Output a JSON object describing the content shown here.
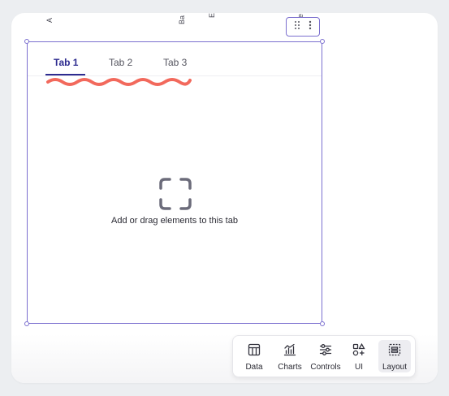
{
  "clipped_labels": [
    "A",
    "Ba",
    "E",
    "e"
  ],
  "tabs": [
    {
      "label": "Tab 1",
      "active": true
    },
    {
      "label": "Tab 2",
      "active": false
    },
    {
      "label": "Tab 3",
      "active": false
    }
  ],
  "empty_state": {
    "icon": "focus-frame-icon",
    "text": "Add or drag elements to this tab"
  },
  "toolbar": {
    "items": [
      {
        "label": "Data",
        "icon": "table-icon",
        "selected": false
      },
      {
        "label": "Charts",
        "icon": "chart-icon",
        "selected": false
      },
      {
        "label": "Controls",
        "icon": "sliders-icon",
        "selected": false
      },
      {
        "label": "UI",
        "icon": "shapes-icon",
        "selected": false
      },
      {
        "label": "Layout",
        "icon": "layout-icon",
        "selected": true
      }
    ]
  },
  "colors": {
    "selection": "#7b6fcf",
    "active_tab": "#2d2b8f",
    "squiggle": "#f2695c"
  }
}
